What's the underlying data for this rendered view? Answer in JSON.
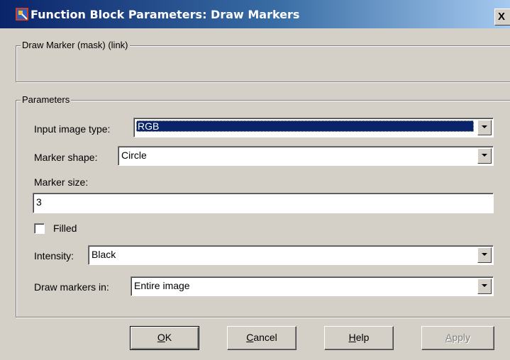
{
  "window": {
    "title": "Function Block Parameters: Draw Markers",
    "close_glyph": "X"
  },
  "mask_group": {
    "legend": "Draw Marker (mask) (link)"
  },
  "params_group": {
    "legend": "Parameters",
    "input_image_type": {
      "label": "Input image type:",
      "value": "RGB"
    },
    "marker_shape": {
      "label": "Marker shape:",
      "value": "Circle"
    },
    "marker_size": {
      "label": "Marker size:",
      "value": "3"
    },
    "filled": {
      "label": "Filled",
      "checked": false
    },
    "intensity": {
      "label": "Intensity:",
      "value": "Black"
    },
    "draw_markers_in": {
      "label": "Draw markers in:",
      "value": "Entire image"
    }
  },
  "buttons": {
    "ok": {
      "mnemonic": "O",
      "rest": "K"
    },
    "cancel": {
      "mnemonic": "C",
      "rest": "ancel"
    },
    "help": {
      "mnemonic": "H",
      "rest": "elp"
    },
    "apply": {
      "mnemonic": "A",
      "rest": "pply"
    }
  },
  "icons": {
    "app": "simulink-block-icon",
    "close": "close-icon",
    "dropdown": "chevron-down-icon",
    "checkbox": "checkbox-icon"
  },
  "colors": {
    "title_start": "#0a246a",
    "title_end": "#a6caf0",
    "dialog_bg": "#d4d0c8",
    "selection": "#0a246a"
  }
}
